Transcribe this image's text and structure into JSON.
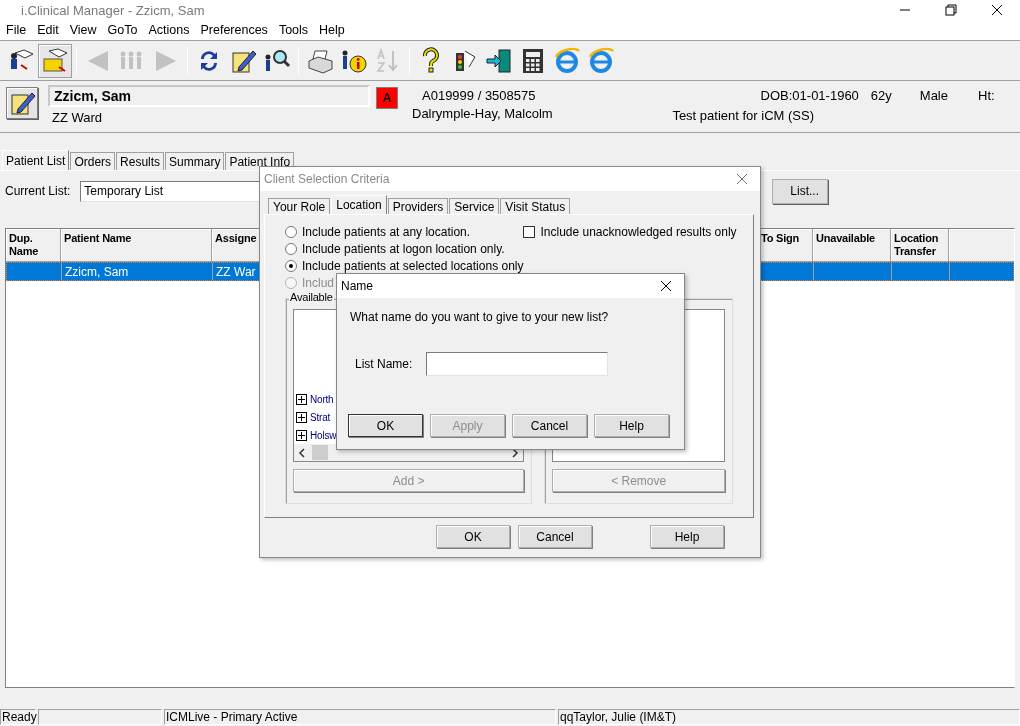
{
  "window": {
    "title": "i.Clinical Manager - Zzicm, Sam"
  },
  "menu": [
    "File",
    "Edit",
    "View",
    "GoTo",
    "Actions",
    "Preferences",
    "Tools",
    "Help"
  ],
  "toolbar": {
    "groups": [
      [
        {
          "kind": "patient-book",
          "disabled": false,
          "pressed": false
        },
        {
          "kind": "folder",
          "disabled": false,
          "pressed": true
        }
      ],
      [
        {
          "kind": "back",
          "disabled": true,
          "pressed": false
        },
        {
          "kind": "people",
          "disabled": true,
          "pressed": false
        },
        {
          "kind": "forward",
          "disabled": true,
          "pressed": false
        }
      ],
      [
        {
          "kind": "refresh",
          "disabled": false,
          "pressed": false
        },
        {
          "kind": "edit",
          "disabled": false,
          "pressed": false
        },
        {
          "kind": "search",
          "disabled": false,
          "pressed": false
        }
      ],
      [
        {
          "kind": "printer",
          "disabled": false,
          "pressed": false
        },
        {
          "kind": "info",
          "disabled": false,
          "pressed": false
        },
        {
          "kind": "sort",
          "disabled": true,
          "pressed": false
        }
      ],
      [
        {
          "kind": "help",
          "disabled": false,
          "pressed": false
        },
        {
          "kind": "traffic",
          "disabled": false,
          "pressed": false
        },
        {
          "kind": "exit",
          "disabled": false,
          "pressed": false
        },
        {
          "kind": "calculator",
          "disabled": false,
          "pressed": false
        },
        {
          "kind": "browser",
          "disabled": false,
          "pressed": false
        },
        {
          "kind": "browser",
          "disabled": false,
          "pressed": false
        }
      ]
    ]
  },
  "patient": {
    "name": "Zzicm, Sam",
    "ward": "ZZ Ward",
    "alert": "A",
    "ids": "A019999 / 3508575",
    "provider": "Dalrymple-Hay, Malcolm",
    "dob": "DOB:01-01-1960",
    "age": "62y",
    "sex": "Male",
    "height": "Ht:",
    "note": "Test patient for iCM (SS)"
  },
  "tabs": [
    {
      "label": "Patient List",
      "selected": true
    },
    {
      "label": "Orders",
      "selected": false
    },
    {
      "label": "Results",
      "selected": false
    },
    {
      "label": "Summary",
      "selected": false
    },
    {
      "label": "Patient Info",
      "selected": false
    }
  ],
  "current_list": {
    "label": "Current List:",
    "value": "Temporary List",
    "button": "List..."
  },
  "table": {
    "columns": [
      "Dup. Name",
      "Patient Name",
      "Assigne",
      "To Sign",
      "Unavailable",
      "Location Transfer"
    ],
    "rows": [
      {
        "selected": true,
        "patient_name": "Zzicm, Sam",
        "column_3": "ZZ War"
      }
    ]
  },
  "criteria_dialog": {
    "title": "Client Selection Criteria",
    "tabs": [
      {
        "label": "Your Role",
        "selected": false
      },
      {
        "label": "Location",
        "selected": true
      },
      {
        "label": "Providers",
        "selected": false
      },
      {
        "label": "Service",
        "selected": false
      },
      {
        "label": "Visit Status",
        "selected": false
      }
    ],
    "options": [
      {
        "label": "Include patients at any location.",
        "selected": false,
        "disabled": false
      },
      {
        "label": "Include patients at logon location only.",
        "selected": false,
        "disabled": false
      },
      {
        "label": "Include patients at selected locations only",
        "selected": true,
        "disabled": false
      },
      {
        "label": "Includ",
        "selected": false,
        "disabled": true
      }
    ],
    "checkbox": {
      "label": "Include unacknowledged results only",
      "checked": false
    },
    "available_label": "Available",
    "tree": [
      {
        "label": "North",
        "expanded": false
      },
      {
        "label": "Strat",
        "expanded": false
      },
      {
        "label": "Holsw",
        "expanded": false
      }
    ],
    "add_button": {
      "label": "Add >",
      "disabled": true
    },
    "remove_button": {
      "label": "< Remove",
      "disabled": true
    },
    "buttons": [
      {
        "label": "OK"
      },
      {
        "label": "Cancel"
      },
      {
        "label": "Help"
      }
    ]
  },
  "name_dialog": {
    "title": "Name",
    "prompt": "What name do you want to give to your new list?",
    "field_label": "List Name:",
    "buttons": [
      {
        "label": "OK",
        "disabled": false,
        "default": true
      },
      {
        "label": "Apply",
        "disabled": true,
        "default": false
      },
      {
        "label": "Cancel",
        "disabled": false,
        "default": false
      },
      {
        "label": "Help",
        "disabled": false,
        "default": false
      }
    ]
  },
  "status_bar": {
    "state": "Ready",
    "server": "ICMLive - Primary Active",
    "user": "qqTaylor, Julie (IM&T)"
  }
}
